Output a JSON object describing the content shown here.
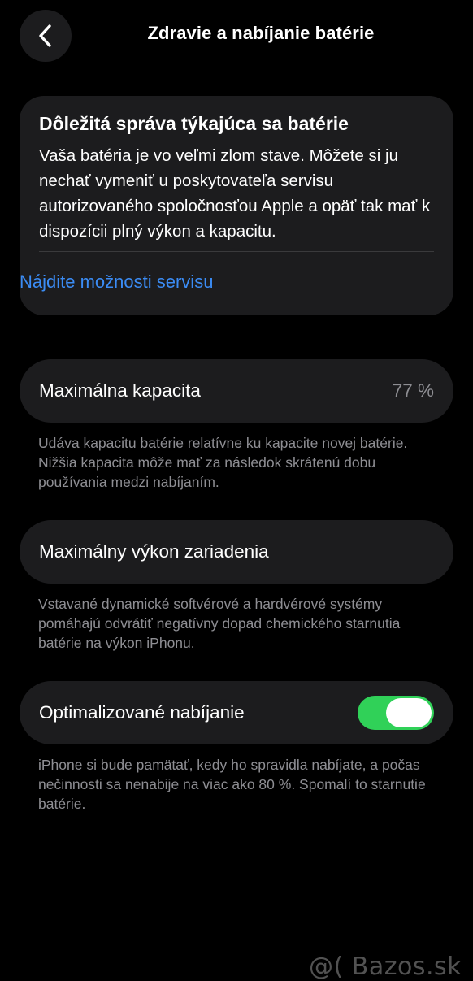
{
  "nav": {
    "title": "Zdravie a nabíjanie batérie",
    "back_icon": "chevron-left-icon"
  },
  "message_card": {
    "title": "Dôležitá správa týkajúca sa batérie",
    "body": "Vaša batéria je vo veľmi zlom stave. Môžete si ju nechať vymeniť u poskytovateľa servisu autorizovaného spoločnosťou Apple a opäť tak mať k dispozícii plný výkon a kapacitu.",
    "link_label": "Nájdite možnosti servisu"
  },
  "max_capacity": {
    "label": "Maximálna kapacita",
    "value": "77 %",
    "note": "Udáva kapacitu batérie relatívne ku kapacite novej batérie. Nižšia kapacita môže mať za následok skrátenú dobu používania medzi nabíjaním."
  },
  "peak_performance": {
    "label": "Maximálny výkon zariadenia",
    "note": "Vstavané dynamické softvérové a hardvérové systémy pomáhajú odvrátiť negatívny dopad chemického starnutia batérie na výkon iPhonu."
  },
  "optimized_charging": {
    "label": "Optimalizované nabíjanie",
    "enabled": true,
    "note": "iPhone si bude pamätať, kedy ho spravidla nabíjate, a počas nečinnosti sa nenabije na viac ako 80 %. Spomalí to starnutie batérie."
  },
  "colors": {
    "background": "#000000",
    "card": "#1c1c1e",
    "link": "#3b8cf5",
    "toggle_on": "#30d158",
    "secondary_text": "#8e8e93"
  },
  "watermark": "@( Bazos.sk"
}
